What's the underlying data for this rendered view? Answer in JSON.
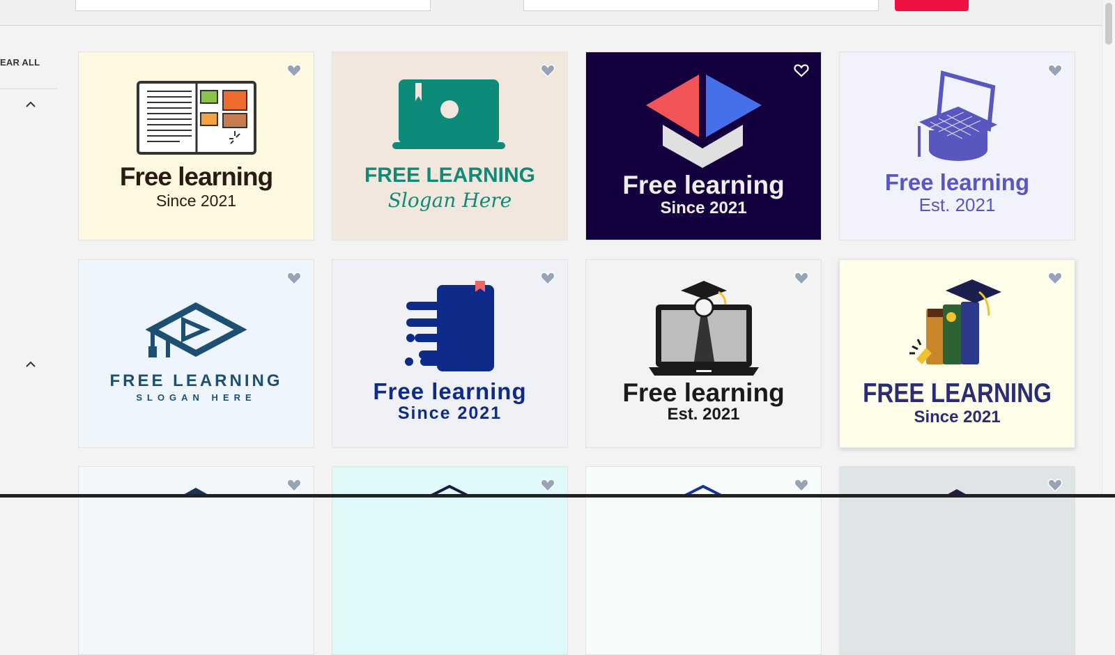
{
  "filters": {
    "clear_all_label": "EAR ALL"
  },
  "cards": [
    {
      "title": "Free learning",
      "subtitle": "Since 2021"
    },
    {
      "title": "FREE LEARNING",
      "subtitle": "Slogan Here"
    },
    {
      "title": "Free learning",
      "subtitle": "Since 2021"
    },
    {
      "title": "Free learning",
      "subtitle": "Est. 2021"
    },
    {
      "title": "FREE LEARNING",
      "subtitle": "SLOGAN HERE"
    },
    {
      "title": "Free learning",
      "subtitle": "Since 2021"
    },
    {
      "title": "Free learning",
      "subtitle": "Est. 2021"
    },
    {
      "title": "FREE LEARNING",
      "subtitle": "Since 2021"
    }
  ],
  "colors": {
    "accent": "#ee1144",
    "heart": "#97a3b6"
  }
}
